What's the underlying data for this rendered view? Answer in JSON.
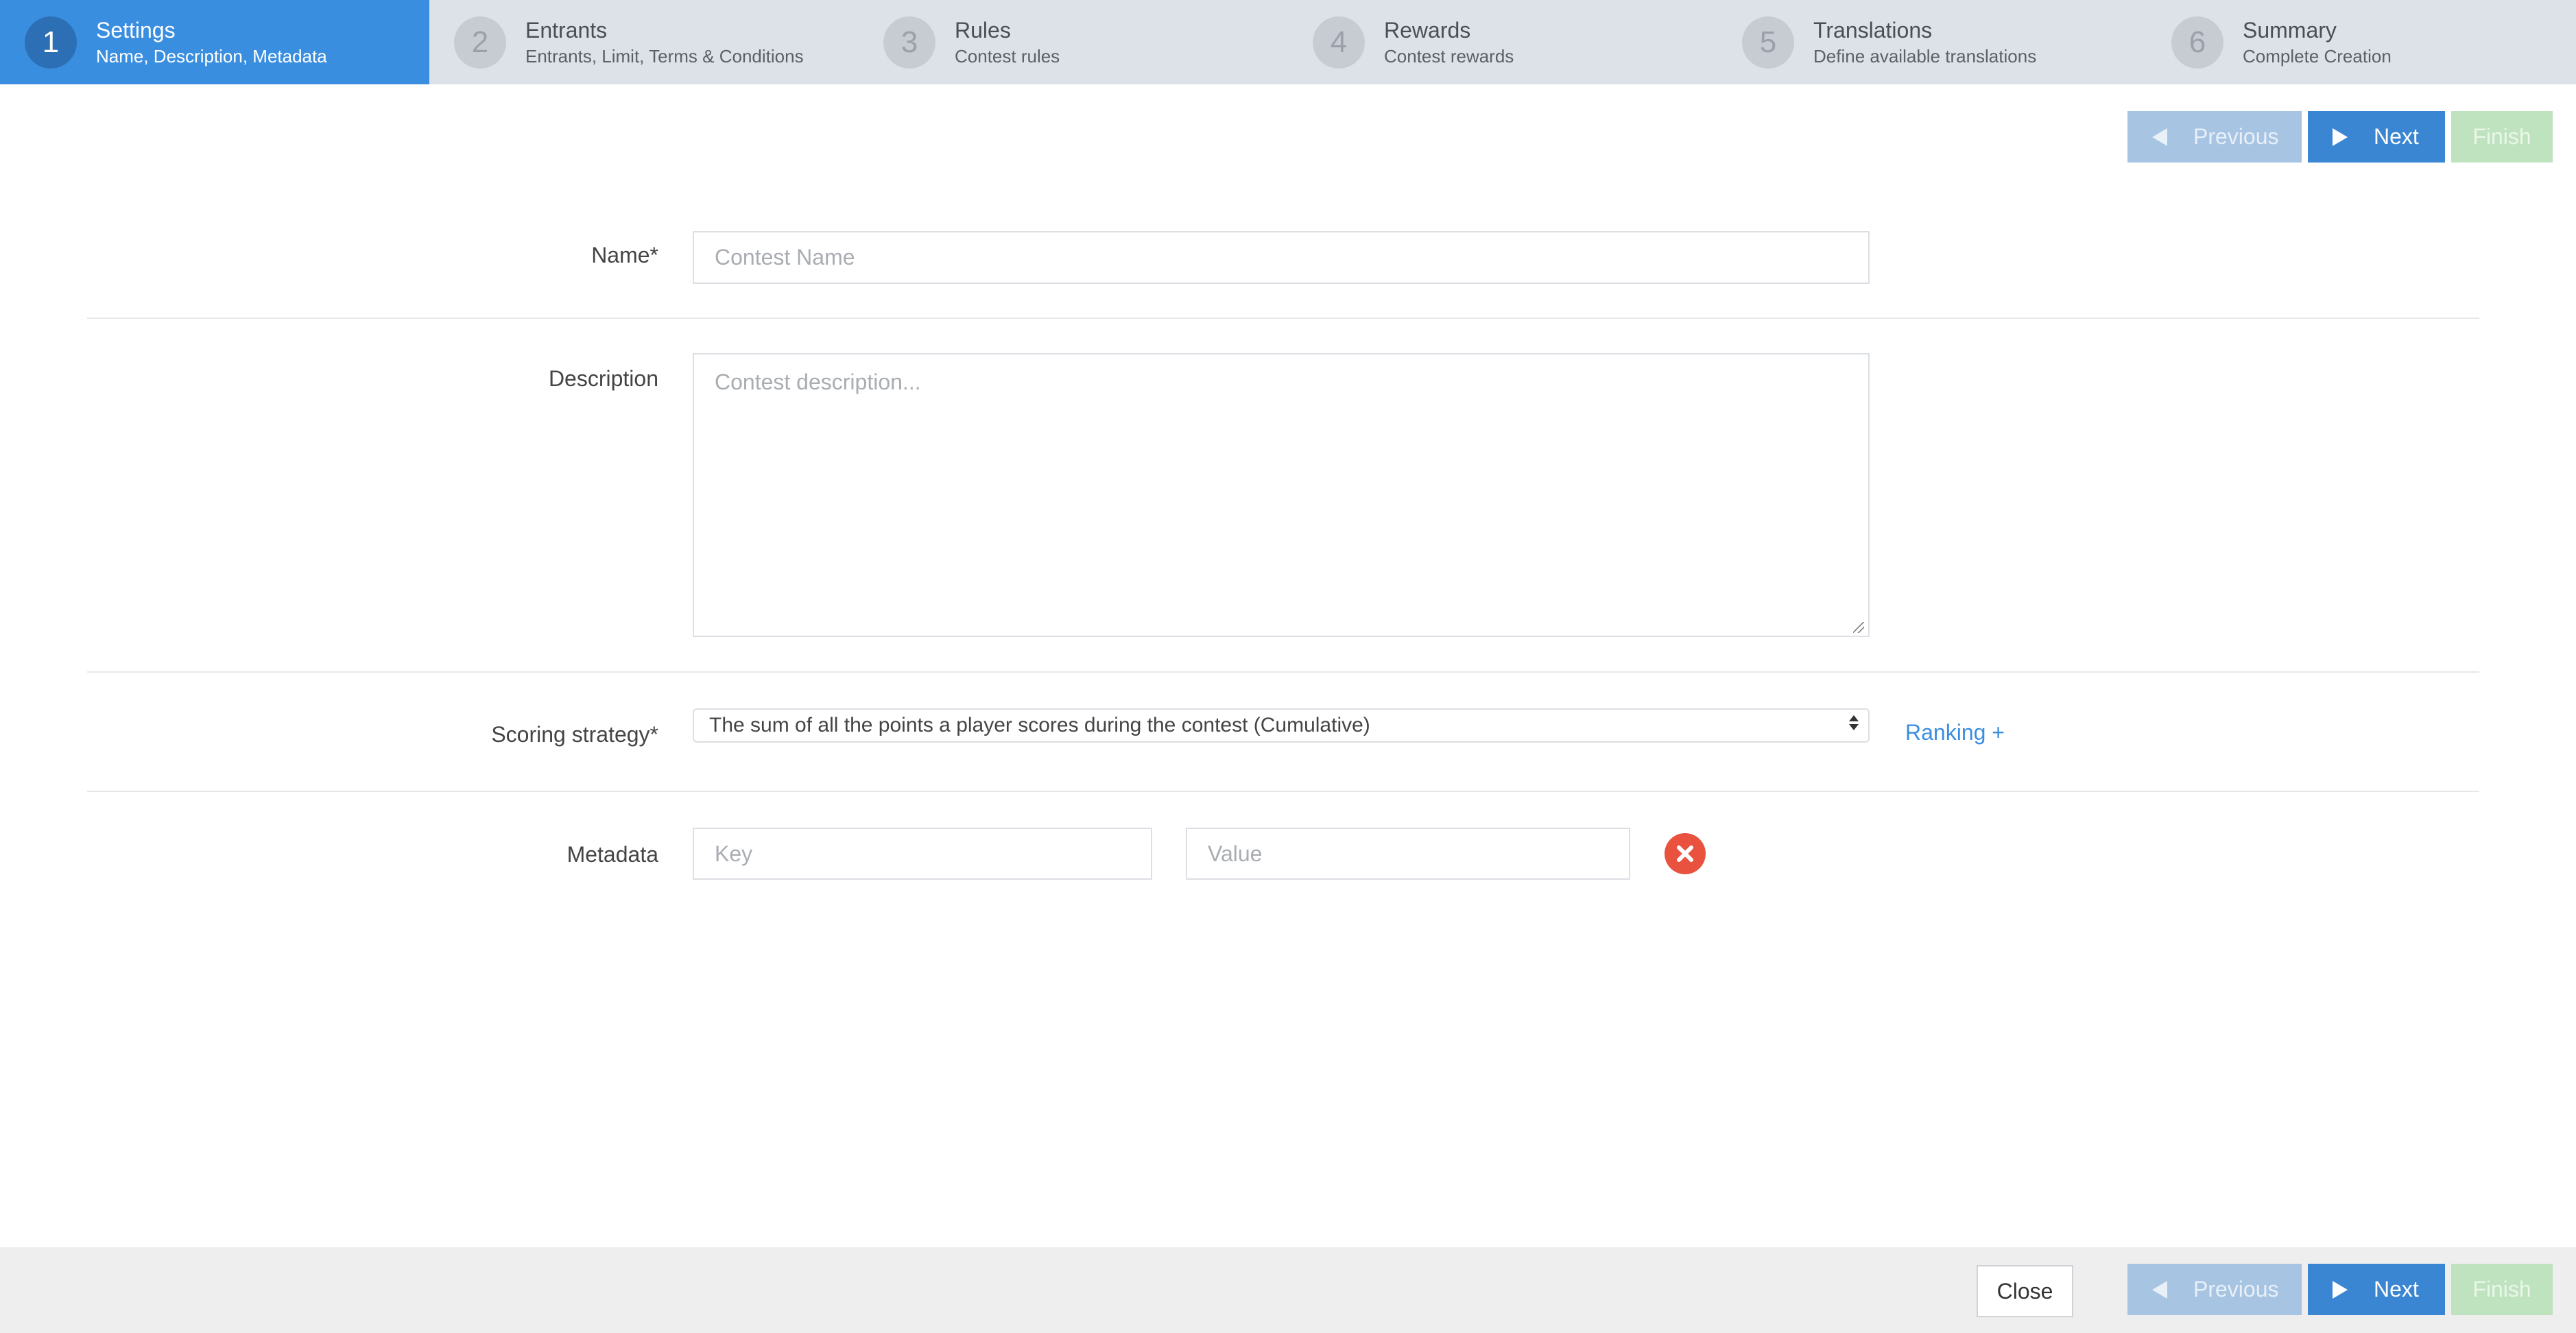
{
  "steps": [
    {
      "num": "1",
      "title": "Settings",
      "subtitle": "Name, Description, Metadata"
    },
    {
      "num": "2",
      "title": "Entrants",
      "subtitle": "Entrants, Limit, Terms & Conditions"
    },
    {
      "num": "3",
      "title": "Rules",
      "subtitle": "Contest rules"
    },
    {
      "num": "4",
      "title": "Rewards",
      "subtitle": "Contest rewards"
    },
    {
      "num": "5",
      "title": "Translations",
      "subtitle": "Define available translations"
    },
    {
      "num": "6",
      "title": "Summary",
      "subtitle": "Complete Creation"
    }
  ],
  "wizard": {
    "previous_label": "Previous",
    "next_label": "Next",
    "finish_label": "Finish"
  },
  "form": {
    "name": {
      "label": "Name*",
      "placeholder": "Contest Name"
    },
    "description": {
      "label": "Description",
      "placeholder": "Contest description..."
    },
    "scoring": {
      "label": "Scoring strategy*",
      "selected": "The sum of all the points a player scores during the contest (Cumulative)",
      "ranking_link": "Ranking  +"
    },
    "metadata": {
      "label": "Metadata",
      "key_placeholder": "Key",
      "value_placeholder": "Value"
    }
  },
  "footer": {
    "close_label": "Close"
  },
  "colors": {
    "active_step": "#3a8ee0",
    "steps_bg": "#dde2e9",
    "next_button": "#3a86d2",
    "previous_button_disabled": "#a7c4e3",
    "finish_button_disabled": "#bfe3bf",
    "remove_icon": "#e9523f",
    "link": "#3a8ee0"
  }
}
